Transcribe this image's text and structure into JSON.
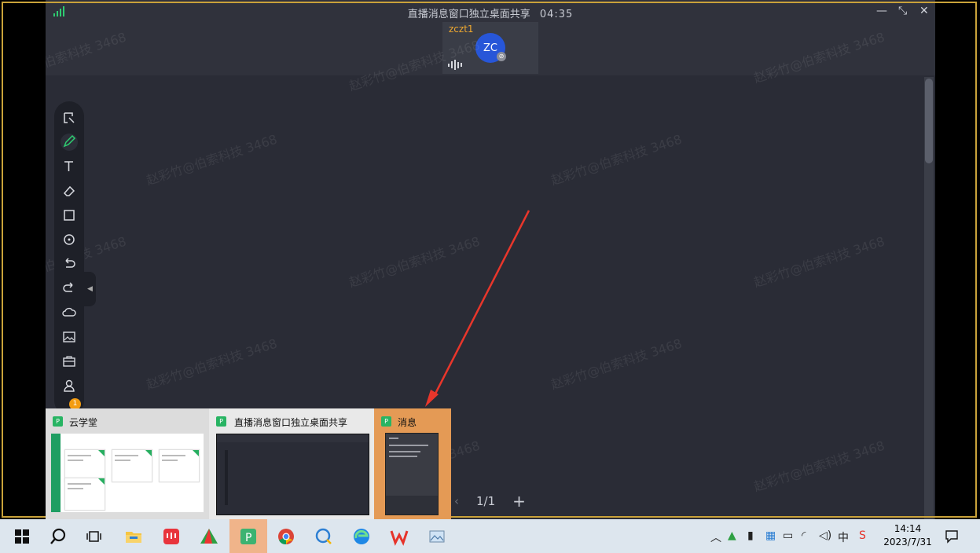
{
  "window": {
    "title": "直播消息窗口独立桌面共享",
    "timer": "04:35",
    "controls": {
      "minimize": "—",
      "restore": "⤡",
      "close": "✕"
    }
  },
  "participant": {
    "name": "zczt1",
    "initials": "ZC"
  },
  "toolbar": {
    "items": [
      "select-icon",
      "pen-icon",
      "text-icon",
      "eraser-icon",
      "shape-icon",
      "laser-pointer-icon",
      "undo-icon",
      "redo-icon",
      "cloud-upload-icon",
      "image-icon",
      "toolbox-icon",
      "user-icon"
    ],
    "badge_count": "1"
  },
  "watermark": "赵彩竹@伯索科技 3468",
  "pager": {
    "prev": "‹",
    "page": "1/1",
    "add": "+"
  },
  "preview": {
    "items": [
      {
        "label": "云学堂"
      },
      {
        "label": "直播消息窗口独立桌面共享"
      },
      {
        "label": "消息"
      }
    ]
  },
  "taskbar": {
    "clock_time": "14:14",
    "clock_date": "2023/7/31"
  },
  "colors": {
    "accent": "#f0b48a",
    "annotation_arrow": "#e8362b",
    "canvas": "#2a2c36"
  }
}
